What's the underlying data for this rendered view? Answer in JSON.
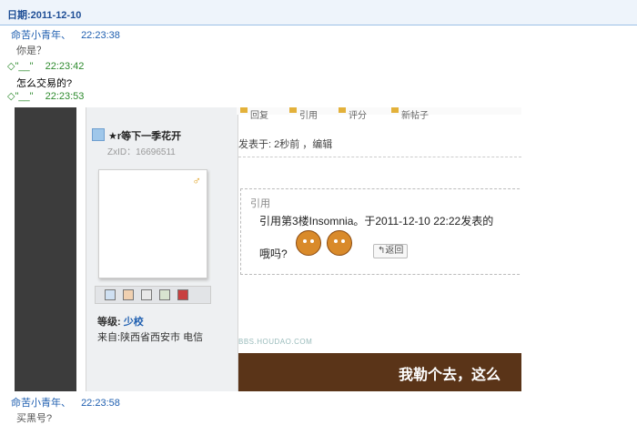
{
  "date_header": "日期:2011-12-10",
  "messages": [
    {
      "sender": "命苦小青年、",
      "time": "22:23:38",
      "text": "你是？"
    },
    {
      "sender": "◇\"__\"",
      "time": "22:23:42",
      "text": ""
    },
    {
      "sender": "",
      "time": "",
      "text": "怎么交易的?"
    },
    {
      "sender": "◇\"__\"",
      "time": "22:23:53",
      "text": ""
    }
  ],
  "after_messages": [
    {
      "sender": "命苦小青年、",
      "time": "22:23:58",
      "text": "买黑号?"
    }
  ],
  "screenshot": {
    "toolbar": [
      "回复",
      "引用",
      "评分",
      "新帖子"
    ],
    "username": "★r等下一季花开",
    "zxid": "ZxID：16696511",
    "level_label": "等级:",
    "level_value": "少校",
    "origin": "来自:陕西省西安市 电信",
    "posted": "发表于: 2秒前    ，编辑",
    "quote_title": "引用",
    "quote_line1": "引用第3楼Insomnia。于2011-12-10 22:22发表的",
    "quote_line2": "哦吗?",
    "back_label": "↰返回",
    "bbs": "BBS.HOUDAO.COM",
    "banner": "我勒个去，这么"
  },
  "colors": {
    "sender_a": "#1f5fb0",
    "sender_b": "#2e8b2e",
    "header_bg": "#eef4fb"
  }
}
